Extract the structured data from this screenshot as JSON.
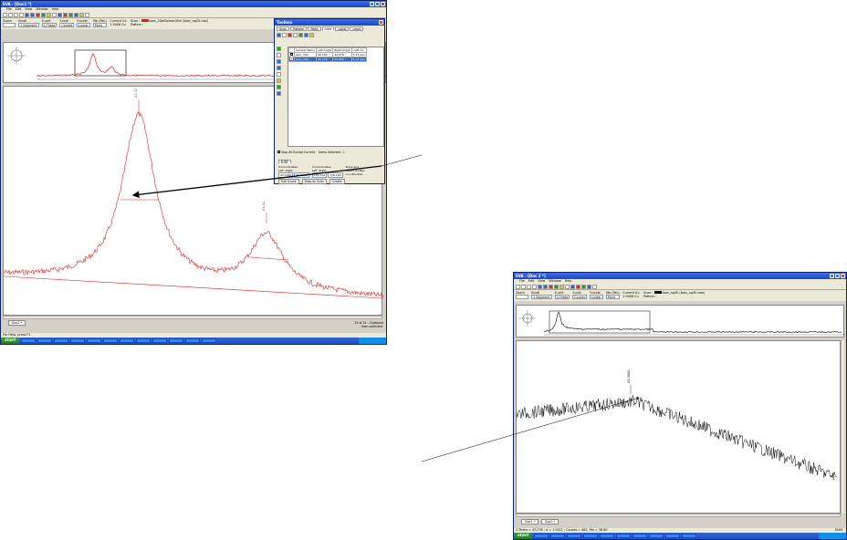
{
  "left_window": {
    "title": "EVA - [Doc1 *]",
    "menu": [
      "File",
      "Edit",
      "View",
      "Window",
      "Help"
    ],
    "controls": {
      "zoom_label": "Zoom",
      "scroll_label": "Scroll",
      "scroll_value": "1 Segment",
      "xunit_label": "X-unit",
      "xunit_value": "2-Theta",
      "yunit_label": "Y-unit",
      "yunit_value": "Counts",
      "yscale_label": "Y-scale",
      "yscale_value": "Linear",
      "sfe_label": "Sfe (Pat.)",
      "sfe_value": "Point",
      "current_vl_label": "Current V.L.",
      "current_vl_value": "1.5406 Cu",
      "scan_label": "Scan :",
      "scan_value": "barc_20pf0pmw.0Sm (barc_ng25.raw)",
      "pattern_label": "Pattern :"
    },
    "doc_tab": "Doc1 *",
    "status_left": "For Help, press F1",
    "status_right": "24 of 24 - Clipboard",
    "status_right2": "Item collected.",
    "taskbar_start": "start",
    "peak_label_1": "41.32",
    "peak_label_2": "43.41"
  },
  "toolbox": {
    "title": "Toolbox",
    "tabs_row1": [
      "Scan",
      "Pattern",
      "Peak",
      "Area",
      "Label",
      "Level"
    ],
    "table_headers": [
      "Sample Name",
      "Left Angle",
      "Right Angle",
      "Left Int."
    ],
    "rows": [
      {
        "name": "barc_20p...",
        "left": "36.169 °",
        "right": "42.978 °",
        "int": "5.11 Cps"
      },
      {
        "name": "barc_20p...",
        "left": "43.378 °",
        "right": "45.960 °",
        "int": "5.14 Cps"
      }
    ],
    "stop_all_label": "Stop All Except Current",
    "items_selected": "Items Selected : 1",
    "edit_tab": "Edit",
    "x_coord_label": "X-Coordinates",
    "y_coord_label": "Y-Coordinates",
    "left_label": "Left",
    "right_label": "Right",
    "x_left": "43.1942",
    "x_right": "49.5605",
    "y_left": "100.114",
    "y_right": "136.163",
    "press_text": "Press and Select Profiles in a Window",
    "btn_edit_scans": "Edit Scans",
    "btn_drop_scan": "Drop on Scan",
    "btn_create": "Create"
  },
  "right_window": {
    "title": "EVA - [Doc 2 *]",
    "menu": [
      "File",
      "Edit",
      "View",
      "Window",
      "Help"
    ],
    "controls": {
      "zoom_label": "Zoom",
      "scroll_label": "Scroll",
      "scroll_value": "1 Segment",
      "xunit_label": "X-unit",
      "xunit_value": "2-Theta",
      "yunit_label": "Y-unit",
      "yunit_value": "Counts",
      "yscale_label": "Y-scale",
      "yscale_value": "Linear",
      "sfe_label": "Sfe (Pat.)",
      "sfe_value": "Point",
      "current_vl_label": "Current V.L.",
      "current_vl_value": "1.5406 Cu",
      "scan_label": "Scan :",
      "scan_value": "barc_ng30 (barc_ng30.raw)",
      "pattern_label": "Pattern :"
    },
    "doc_tabs": [
      "Doc1 *",
      "Doc2 *"
    ],
    "status_left": "2-Theta = 47.276 ; d = 1.9211 ; Counts = 461, Pts = 36.80",
    "status_right": "NUM",
    "taskbar_start": "start",
    "peak_label": "43.4000"
  },
  "colors": {
    "left_trace": "#e02020",
    "right_trace": "#000000",
    "title_blue": "#1c46c8",
    "arrow": "#000000"
  }
}
